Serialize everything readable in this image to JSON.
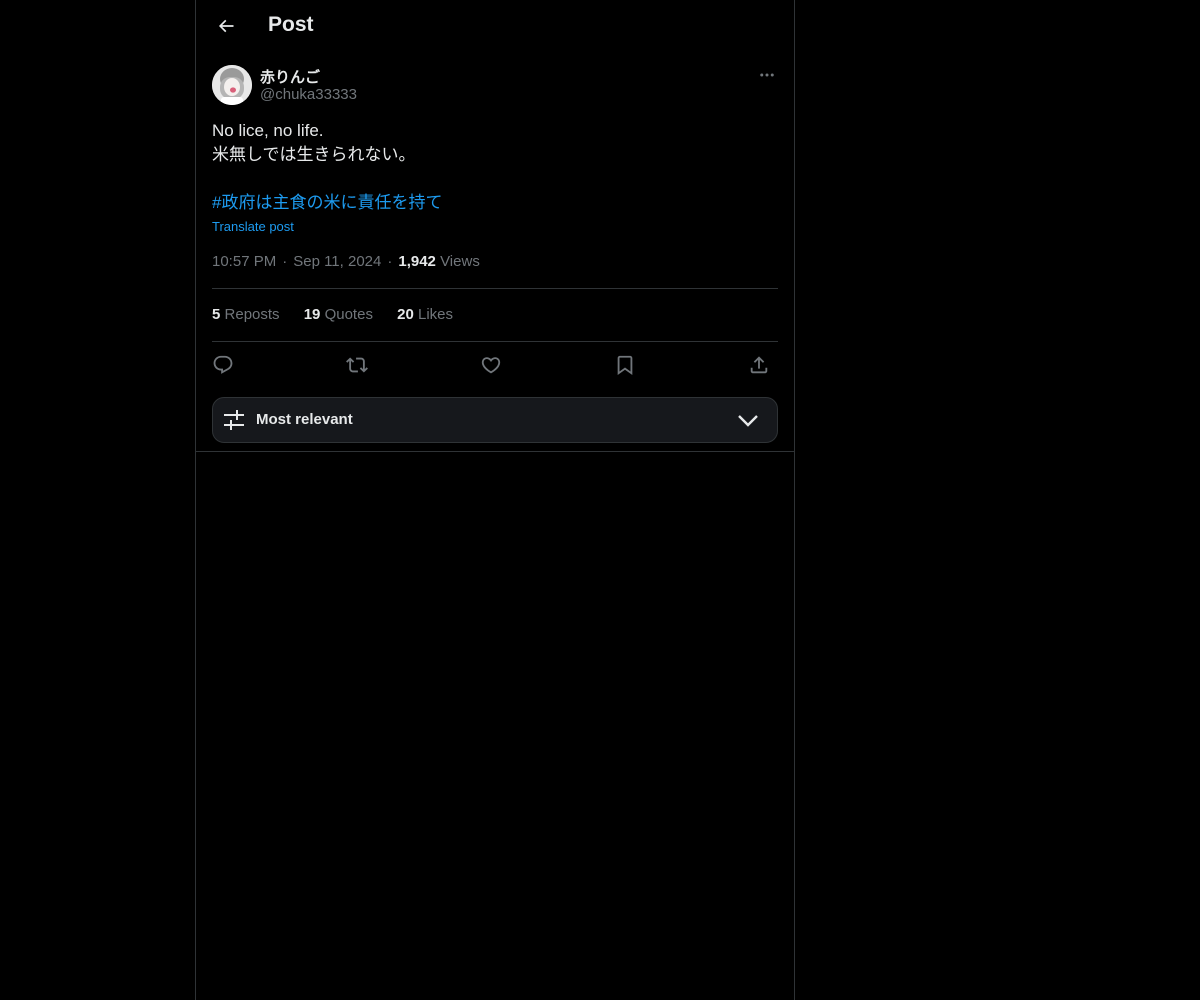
{
  "header": {
    "title": "Post",
    "back_icon": "arrow-left-icon"
  },
  "post": {
    "author": {
      "name": "赤りんご",
      "handle": "@chuka33333"
    },
    "text_lines": [
      "No lice, no life.",
      "米無しでは生きられない。"
    ],
    "hashtag": "#政府は主食の米に責任を持て",
    "translate_label": "Translate post",
    "time": "10:57 PM",
    "date": "Sep 11, 2024",
    "views_count": "1,942",
    "views_label": "Views"
  },
  "stats": {
    "reposts": {
      "count": "5",
      "label": "Reposts"
    },
    "quotes": {
      "count": "19",
      "label": "Quotes"
    },
    "likes": {
      "count": "20",
      "label": "Likes"
    }
  },
  "actions": [
    "reply-icon",
    "repost-icon",
    "like-icon",
    "bookmark-icon",
    "share-icon"
  ],
  "sort": {
    "label": "Most relevant"
  },
  "colors": {
    "background": "#000000",
    "text": "#e7e9ea",
    "muted": "#71767b",
    "link": "#1d9bf0",
    "border": "#2f3336"
  }
}
